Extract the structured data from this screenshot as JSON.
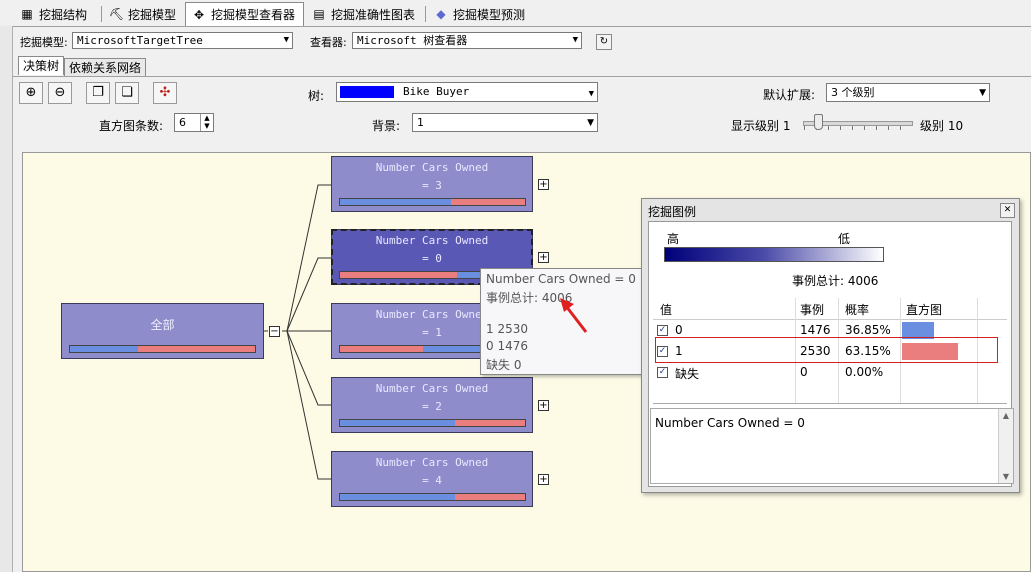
{
  "top_tabs": [
    {
      "label": "挖掘结构",
      "icon": "structure-icon"
    },
    {
      "label": "挖掘模型",
      "icon": "hammer-icon"
    },
    {
      "label": "挖掘模型查看器",
      "icon": "viewer-icon"
    },
    {
      "label": "挖掘准确性图表",
      "icon": "chart-icon"
    },
    {
      "label": "挖掘模型预测",
      "icon": "diamond-icon"
    }
  ],
  "model_label": "挖掘模型:",
  "model_value": "MicrosoftTargetTree",
  "viewer_label": "查看器:",
  "viewer_value": "Microsoft 树查看器",
  "sub_tabs": [
    "决策树",
    "依赖关系网络"
  ],
  "tree_label": "树:",
  "tree_value": "Bike Buyer",
  "tree_color": "#0000ff",
  "default_expand_label": "默认扩展:",
  "default_expand_value": "3 个级别",
  "hist_label": "直方图条数:",
  "hist_value": "6",
  "bg_label": "背景:",
  "bg_value": "1",
  "show_level_label": "显示级别 1",
  "level_max_label": "级别 10",
  "slider_level": 1,
  "root": {
    "label": "全部",
    "blue_fraction": 0.37
  },
  "nodes": [
    {
      "line1": "Number Cars Owned",
      "line2": "= 3",
      "blue_fraction": 0.6
    },
    {
      "line1": "Number Cars Owned",
      "line2": "= 0",
      "blue_fraction": 0.37
    },
    {
      "line1": "Number Cars Owned",
      "line2": "= 1",
      "blue_fraction": 0.55
    },
    {
      "line1": "Number Cars Owned",
      "line2": "= 2",
      "blue_fraction": 0.62
    },
    {
      "line1": "Number Cars Owned",
      "line2": "= 4",
      "blue_fraction": 0.62
    }
  ],
  "tooltip": {
    "title": "Number Cars Owned = 0",
    "total": "事例总计: 4006",
    "lines": [
      "1  2530",
      "0  1476",
      "缺失  0"
    ]
  },
  "legend": {
    "title": "挖掘图例",
    "high": "高",
    "low": "低",
    "total": "事例总计:  4006",
    "headers": [
      "值",
      "事例",
      "概率",
      "直方图"
    ],
    "rows": [
      {
        "value": "0",
        "cases": "1476",
        "prob": "36.85%",
        "hist_fraction": 0.3685,
        "color": "#6b8fe0"
      },
      {
        "value": "1",
        "cases": "2530",
        "prob": "63.15%",
        "hist_fraction": 0.6315,
        "color": "#ea7e7e"
      },
      {
        "value": "缺失",
        "cases": "0",
        "prob": "0.00%",
        "hist_fraction": 0,
        "color": "#cccccc"
      }
    ],
    "description": "Number Cars Owned = 0"
  }
}
